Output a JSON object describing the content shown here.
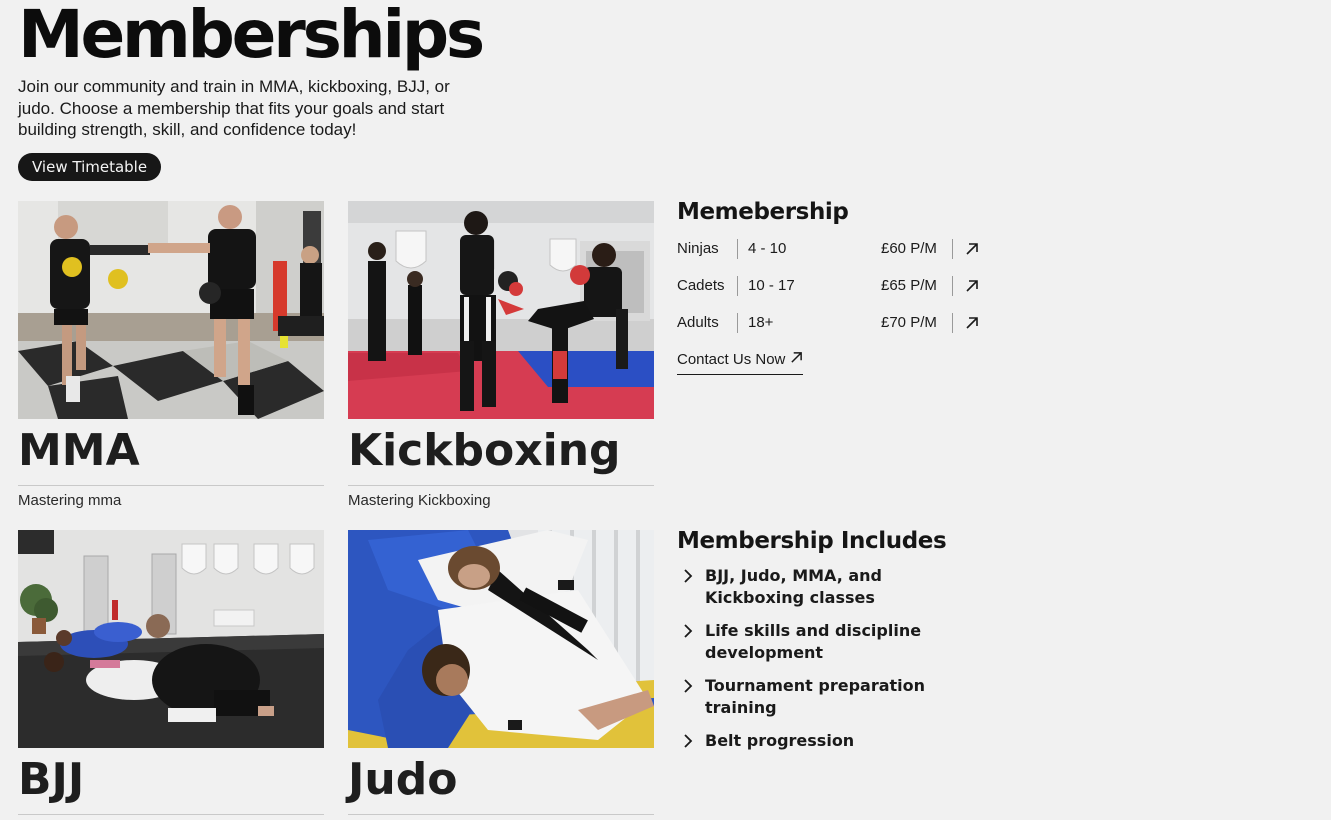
{
  "hero": {
    "title": "Memberships",
    "description": "Join our community and train in MMA, kickboxing, BJJ, or judo. Choose a membership that fits your goals and start building strength, skill, and confidence today!",
    "timetable_button": "View Timetable"
  },
  "classes": [
    {
      "title": "MMA",
      "subtitle": "Mastering mma",
      "image_alt": "Two fighters sparring in an MMA gym"
    },
    {
      "title": "Kickboxing",
      "subtitle": "Mastering Kickboxing",
      "image_alt": "Kickboxing class practicing kicks on mats"
    },
    {
      "title": "BJJ",
      "subtitle": "",
      "image_alt": "BJJ grappling on the mats"
    },
    {
      "title": "Judo",
      "subtitle": "",
      "image_alt": "Judo throw in training"
    }
  ],
  "membership": {
    "heading": "Memebership",
    "rows": [
      {
        "tier": "Ninjas",
        "age": "4 - 10",
        "price": "£60 P/M",
        "icon": "arrow-up-right-icon"
      },
      {
        "tier": "Cadets",
        "age": "10 - 17",
        "price": "£65 P/M",
        "icon": "arrow-up-right-icon"
      },
      {
        "tier": "Adults",
        "age": "18+",
        "price": "£70 P/M",
        "icon": "arrow-up-right-icon"
      }
    ],
    "contact_link": "Contact Us Now"
  },
  "includes": {
    "heading": "Membership Includes",
    "items": [
      "BJJ, Judo, MMA, and Kickboxing classes",
      "Life skills and discipline development",
      "Tournament preparation training",
      "Belt progression"
    ],
    "icon": "chevron-right-icon"
  },
  "colors": {
    "background": "#f1f1f1",
    "text": "#151515",
    "button_background": "#171717",
    "button_text": "#f4f4f4"
  }
}
